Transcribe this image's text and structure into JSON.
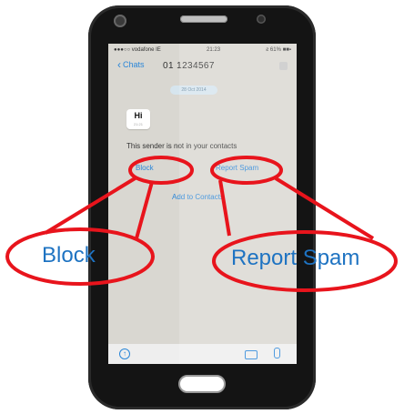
{
  "status_bar": {
    "carrier": "●●●○○ vodafone IE",
    "time": "21:23",
    "battery": "ƨ 61% ■■▪"
  },
  "nav": {
    "back_label": "Chats",
    "contact_title": "01 1234567"
  },
  "chat": {
    "date": "28 Oct 2014",
    "message_text": "Hi",
    "message_time": "21:21"
  },
  "unknown_sender": {
    "notice": "This sender is not in your contacts",
    "block_label": "Block",
    "report_spam_label": "Report Spam",
    "add_contact_label": "Add to Contacts"
  },
  "callouts": {
    "block": "Block",
    "report_spam": "Report Spam"
  },
  "colors": {
    "accent": "#2a86d8",
    "callout_stroke": "#e8141c",
    "callout_text": "#1e73c2",
    "phone_body": "#141414"
  }
}
